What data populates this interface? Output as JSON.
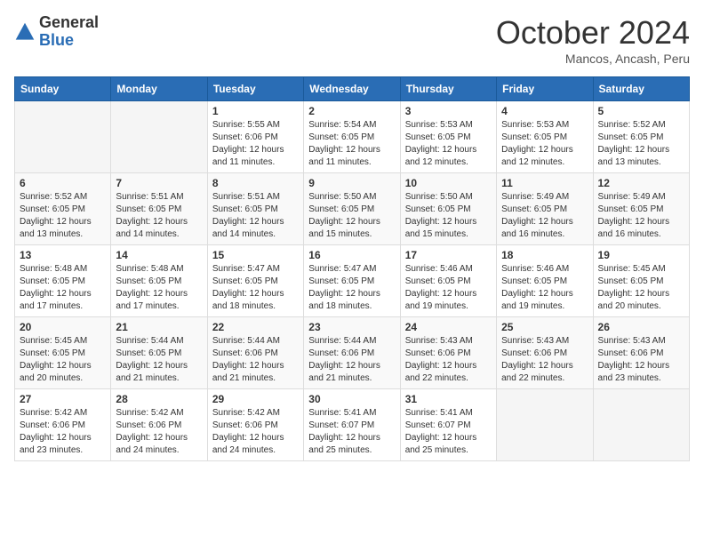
{
  "logo": {
    "general": "General",
    "blue": "Blue"
  },
  "title": "October 2024",
  "location": "Mancos, Ancash, Peru",
  "weekdays": [
    "Sunday",
    "Monday",
    "Tuesday",
    "Wednesday",
    "Thursday",
    "Friday",
    "Saturday"
  ],
  "weeks": [
    [
      {
        "day": "",
        "info": ""
      },
      {
        "day": "",
        "info": ""
      },
      {
        "day": "1",
        "info": "Sunrise: 5:55 AM\nSunset: 6:06 PM\nDaylight: 12 hours and 11 minutes."
      },
      {
        "day": "2",
        "info": "Sunrise: 5:54 AM\nSunset: 6:05 PM\nDaylight: 12 hours and 11 minutes."
      },
      {
        "day": "3",
        "info": "Sunrise: 5:53 AM\nSunset: 6:05 PM\nDaylight: 12 hours and 12 minutes."
      },
      {
        "day": "4",
        "info": "Sunrise: 5:53 AM\nSunset: 6:05 PM\nDaylight: 12 hours and 12 minutes."
      },
      {
        "day": "5",
        "info": "Sunrise: 5:52 AM\nSunset: 6:05 PM\nDaylight: 12 hours and 13 minutes."
      }
    ],
    [
      {
        "day": "6",
        "info": "Sunrise: 5:52 AM\nSunset: 6:05 PM\nDaylight: 12 hours and 13 minutes."
      },
      {
        "day": "7",
        "info": "Sunrise: 5:51 AM\nSunset: 6:05 PM\nDaylight: 12 hours and 14 minutes."
      },
      {
        "day": "8",
        "info": "Sunrise: 5:51 AM\nSunset: 6:05 PM\nDaylight: 12 hours and 14 minutes."
      },
      {
        "day": "9",
        "info": "Sunrise: 5:50 AM\nSunset: 6:05 PM\nDaylight: 12 hours and 15 minutes."
      },
      {
        "day": "10",
        "info": "Sunrise: 5:50 AM\nSunset: 6:05 PM\nDaylight: 12 hours and 15 minutes."
      },
      {
        "day": "11",
        "info": "Sunrise: 5:49 AM\nSunset: 6:05 PM\nDaylight: 12 hours and 16 minutes."
      },
      {
        "day": "12",
        "info": "Sunrise: 5:49 AM\nSunset: 6:05 PM\nDaylight: 12 hours and 16 minutes."
      }
    ],
    [
      {
        "day": "13",
        "info": "Sunrise: 5:48 AM\nSunset: 6:05 PM\nDaylight: 12 hours and 17 minutes."
      },
      {
        "day": "14",
        "info": "Sunrise: 5:48 AM\nSunset: 6:05 PM\nDaylight: 12 hours and 17 minutes."
      },
      {
        "day": "15",
        "info": "Sunrise: 5:47 AM\nSunset: 6:05 PM\nDaylight: 12 hours and 18 minutes."
      },
      {
        "day": "16",
        "info": "Sunrise: 5:47 AM\nSunset: 6:05 PM\nDaylight: 12 hours and 18 minutes."
      },
      {
        "day": "17",
        "info": "Sunrise: 5:46 AM\nSunset: 6:05 PM\nDaylight: 12 hours and 19 minutes."
      },
      {
        "day": "18",
        "info": "Sunrise: 5:46 AM\nSunset: 6:05 PM\nDaylight: 12 hours and 19 minutes."
      },
      {
        "day": "19",
        "info": "Sunrise: 5:45 AM\nSunset: 6:05 PM\nDaylight: 12 hours and 20 minutes."
      }
    ],
    [
      {
        "day": "20",
        "info": "Sunrise: 5:45 AM\nSunset: 6:05 PM\nDaylight: 12 hours and 20 minutes."
      },
      {
        "day": "21",
        "info": "Sunrise: 5:44 AM\nSunset: 6:05 PM\nDaylight: 12 hours and 21 minutes."
      },
      {
        "day": "22",
        "info": "Sunrise: 5:44 AM\nSunset: 6:06 PM\nDaylight: 12 hours and 21 minutes."
      },
      {
        "day": "23",
        "info": "Sunrise: 5:44 AM\nSunset: 6:06 PM\nDaylight: 12 hours and 21 minutes."
      },
      {
        "day": "24",
        "info": "Sunrise: 5:43 AM\nSunset: 6:06 PM\nDaylight: 12 hours and 22 minutes."
      },
      {
        "day": "25",
        "info": "Sunrise: 5:43 AM\nSunset: 6:06 PM\nDaylight: 12 hours and 22 minutes."
      },
      {
        "day": "26",
        "info": "Sunrise: 5:43 AM\nSunset: 6:06 PM\nDaylight: 12 hours and 23 minutes."
      }
    ],
    [
      {
        "day": "27",
        "info": "Sunrise: 5:42 AM\nSunset: 6:06 PM\nDaylight: 12 hours and 23 minutes."
      },
      {
        "day": "28",
        "info": "Sunrise: 5:42 AM\nSunset: 6:06 PM\nDaylight: 12 hours and 24 minutes."
      },
      {
        "day": "29",
        "info": "Sunrise: 5:42 AM\nSunset: 6:06 PM\nDaylight: 12 hours and 24 minutes."
      },
      {
        "day": "30",
        "info": "Sunrise: 5:41 AM\nSunset: 6:07 PM\nDaylight: 12 hours and 25 minutes."
      },
      {
        "day": "31",
        "info": "Sunrise: 5:41 AM\nSunset: 6:07 PM\nDaylight: 12 hours and 25 minutes."
      },
      {
        "day": "",
        "info": ""
      },
      {
        "day": "",
        "info": ""
      }
    ]
  ]
}
